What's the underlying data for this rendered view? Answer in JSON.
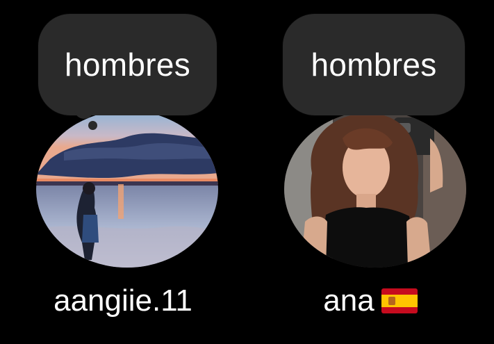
{
  "profiles": [
    {
      "note": "hombres",
      "username": "aangiie.11",
      "has_flag": false
    },
    {
      "note": "hombres",
      "username": "ana",
      "flag_icon": "spain-flag-icon"
    }
  ],
  "colors": {
    "background": "#000000",
    "bubble": "#2a2a2a",
    "text": "#ffffff"
  }
}
